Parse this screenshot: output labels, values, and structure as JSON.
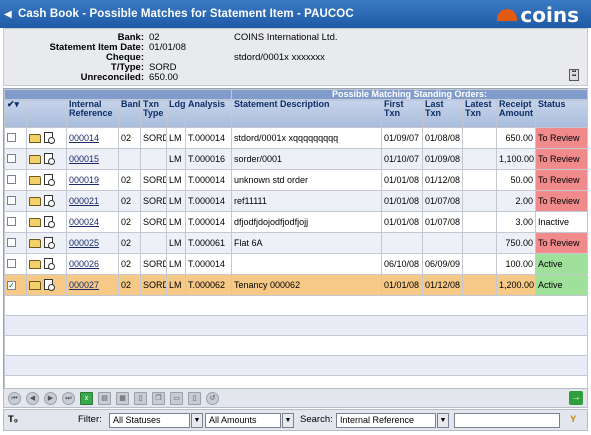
{
  "window": {
    "title": "Cash Book - Possible Matches for Statement Item - PAUCOC",
    "logo_text": "coins"
  },
  "statement": {
    "bank_label": "Bank:",
    "bank_value": "02",
    "bank_name": "COINS International Ltd.",
    "date_label": "Statement Item Date:",
    "date_value": "01/01/08",
    "cheque_label": "Cheque:",
    "cheque_value": "stdord/0001x xxxxxxx",
    "ttype_label": "T/Type:",
    "ttype_value": "SORD",
    "unreconciled_label": "Unreconciled:",
    "unreconciled_value": "650.00"
  },
  "grid": {
    "caption": "Possible Matching Standing Orders:",
    "headers": {
      "ref": "Internal Reference",
      "bank": "Bank",
      "txn": "Txn Type",
      "ldg": "Ldg",
      "analysis": "Analysis",
      "desc": "Statement Description",
      "first": "First Txn",
      "last": "Last Txn",
      "latest": "Latest Txn",
      "receipt": "Receipt Amount",
      "status": "Status"
    },
    "rows": [
      {
        "ref": "000014",
        "bank": "02",
        "txn": "SORD",
        "ldg": "LM",
        "analysis": "T.000014",
        "desc": "stdord/0001x xqqqqqqqqq",
        "first": "01/09/07",
        "last": "01/08/08",
        "latest": "",
        "receipt": "650.00",
        "status": "To Review",
        "checked": ""
      },
      {
        "ref": "000015",
        "bank": "",
        "txn": "",
        "ldg": "LM",
        "analysis": "T.000016",
        "desc": "sorder/0001",
        "first": "01/10/07",
        "last": "01/09/08",
        "latest": "",
        "receipt": "1,100.00",
        "status": "To Review",
        "checked": ""
      },
      {
        "ref": "000019",
        "bank": "02",
        "txn": "SORD",
        "ldg": "LM",
        "analysis": "T.000014",
        "desc": "unknown std order",
        "first": "01/01/08",
        "last": "01/12/08",
        "latest": "",
        "receipt": "50.00",
        "status": "To Review",
        "checked": ""
      },
      {
        "ref": "000021",
        "bank": "02",
        "txn": "SORD",
        "ldg": "LM",
        "analysis": "T.000014",
        "desc": "ref11111",
        "first": "01/01/08",
        "last": "01/07/08",
        "latest": "",
        "receipt": "2.00",
        "status": "To Review",
        "checked": ""
      },
      {
        "ref": "000024",
        "bank": "02",
        "txn": "SORD",
        "ldg": "LM",
        "analysis": "T.000014",
        "desc": "dfjodfjdojodfjodfjojj",
        "first": "01/01/08",
        "last": "01/07/08",
        "latest": "",
        "receipt": "3.00",
        "status": "Inactive",
        "checked": ""
      },
      {
        "ref": "000025",
        "bank": "02",
        "txn": "",
        "ldg": "LM",
        "analysis": "T.000061",
        "desc": "Flat 6A",
        "first": "",
        "last": "",
        "latest": "",
        "receipt": "750.00",
        "status": "To Review",
        "checked": ""
      },
      {
        "ref": "000026",
        "bank": "02",
        "txn": "SORD",
        "ldg": "LM",
        "analysis": "T.000014",
        "desc": "",
        "first": "06/10/08",
        "last": "06/09/09",
        "latest": "",
        "receipt": "100.00",
        "status": "Active",
        "checked": ""
      },
      {
        "ref": "000027",
        "bank": "02",
        "txn": "SORD",
        "ldg": "LM",
        "analysis": "T.000062",
        "desc": "Tenancy 000062",
        "first": "01/01/08",
        "last": "01/12/08",
        "latest": "",
        "receipt": "1,200.00",
        "status": "Active",
        "checked": "✓"
      }
    ]
  },
  "filterbar": {
    "filter_label": "Filter:",
    "status_value": "All Statuses",
    "amount_value": "All Amounts",
    "search_label": "Search:",
    "search_field_value": "Internal Reference",
    "search_text": ""
  },
  "colors": {
    "title_bar": "#2a68b6",
    "review": "#f18b8b",
    "active": "#9fe09a",
    "selected_row": "#f6c987"
  }
}
